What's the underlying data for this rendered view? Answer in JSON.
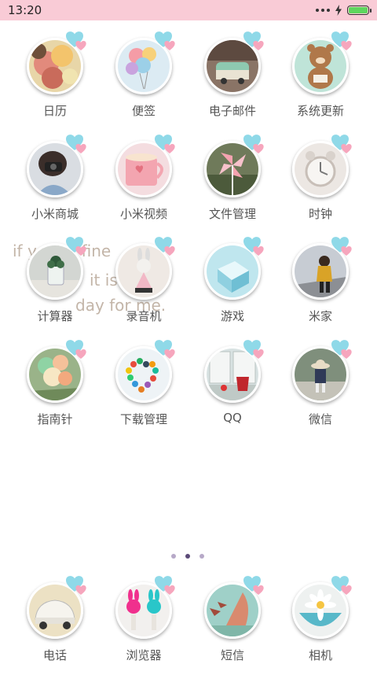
{
  "status_bar": {
    "time": "13:20",
    "battery_level": 1.0
  },
  "wallpaper_text": [
    "if you're fine",
    "it is a fine",
    "day for me."
  ],
  "apps": [
    {
      "label": "日历",
      "icon": "balloons-photo-icon"
    },
    {
      "label": "便签",
      "icon": "balloons-sky-icon"
    },
    {
      "label": "电子邮件",
      "icon": "vw-bus-icon"
    },
    {
      "label": "系统更新",
      "icon": "bear-toy-icon"
    },
    {
      "label": "小米商城",
      "icon": "camera-girl-icon"
    },
    {
      "label": "小米视频",
      "icon": "pink-cup-icon"
    },
    {
      "label": "文件管理",
      "icon": "pinwheel-icon"
    },
    {
      "label": "时钟",
      "icon": "alarm-clock-icon"
    },
    {
      "label": "计算器",
      "icon": "plant-jar-icon"
    },
    {
      "label": "录音机",
      "icon": "bunny-toy-icon"
    },
    {
      "label": "游戏",
      "icon": "glass-cube-icon"
    },
    {
      "label": "米家",
      "icon": "street-girl-icon"
    },
    {
      "label": "指南针",
      "icon": "green-balloons-icon"
    },
    {
      "label": "下载管理",
      "icon": "bead-heart-icon"
    },
    {
      "label": "QQ",
      "icon": "red-cup-window-icon"
    },
    {
      "label": "微信",
      "icon": "hat-girl-icon"
    }
  ],
  "pager": {
    "count": 3,
    "active": 2
  },
  "dock": [
    {
      "label": "电话",
      "icon": "white-beetle-icon"
    },
    {
      "label": "浏览器",
      "icon": "bunny-pegs-icon"
    },
    {
      "label": "短信",
      "icon": "flag-balloons-icon"
    },
    {
      "label": "相机",
      "icon": "daisy-bowl-icon"
    }
  ]
}
